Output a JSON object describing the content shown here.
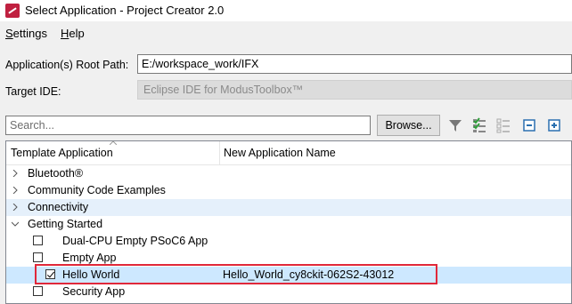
{
  "window": {
    "title": "Select Application - Project Creator 2.0"
  },
  "menu": {
    "settings": "Settings",
    "help": "Help"
  },
  "form": {
    "root_path_label": "Application(s) Root Path:",
    "root_path_value": "E:/workspace_work/IFX",
    "target_ide_label": "Target IDE:",
    "target_ide_value": "Eclipse IDE for ModusToolbox™"
  },
  "search": {
    "placeholder": "Search...",
    "browse_label": "Browse..."
  },
  "table": {
    "col1": "Template Application",
    "col2": "New Application Name",
    "rows": [
      {
        "label": "Bluetooth®",
        "level": 0,
        "expanded": false
      },
      {
        "label": "Community Code Examples",
        "level": 0,
        "expanded": false
      },
      {
        "label": "Connectivity",
        "level": 0,
        "expanded": false
      },
      {
        "label": "Getting Started",
        "level": 0,
        "expanded": true
      },
      {
        "label": "Dual-CPU Empty PSoC6 App",
        "level": 1,
        "checked": false
      },
      {
        "label": "Empty App",
        "level": 1,
        "checked": false
      },
      {
        "label": "Hello World",
        "level": 1,
        "checked": true,
        "app_name": "Hello_World_cy8ckit-062S2-43012"
      },
      {
        "label": "Security App",
        "level": 1,
        "checked": false
      }
    ]
  }
}
